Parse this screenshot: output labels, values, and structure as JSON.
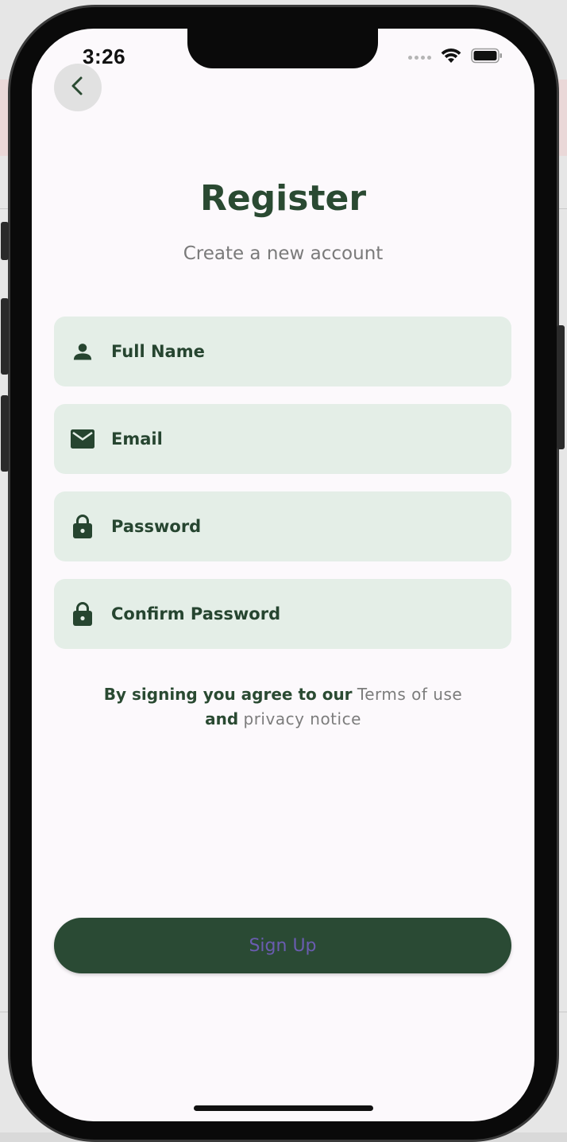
{
  "status_bar": {
    "time": "3:26"
  },
  "header": {
    "title": "Register",
    "subtitle": "Create a new account"
  },
  "form": {
    "fields": [
      {
        "label": "Full Name",
        "icon": "person-icon"
      },
      {
        "label": "Email",
        "icon": "mail-icon"
      },
      {
        "label": "Password",
        "icon": "lock-icon"
      },
      {
        "label": "Confirm Password",
        "icon": "lock-icon"
      }
    ]
  },
  "terms": {
    "prefix": "By signing you agree to our",
    "terms_link": "Terms of use",
    "conjunction": "and",
    "privacy_link": "privacy notice"
  },
  "actions": {
    "signup_label": "Sign Up"
  },
  "colors": {
    "primary_green": "#2a4a34",
    "field_bg": "#e4eee7",
    "signup_text": "#6a5cb0",
    "muted_text": "#7c7c7c"
  }
}
